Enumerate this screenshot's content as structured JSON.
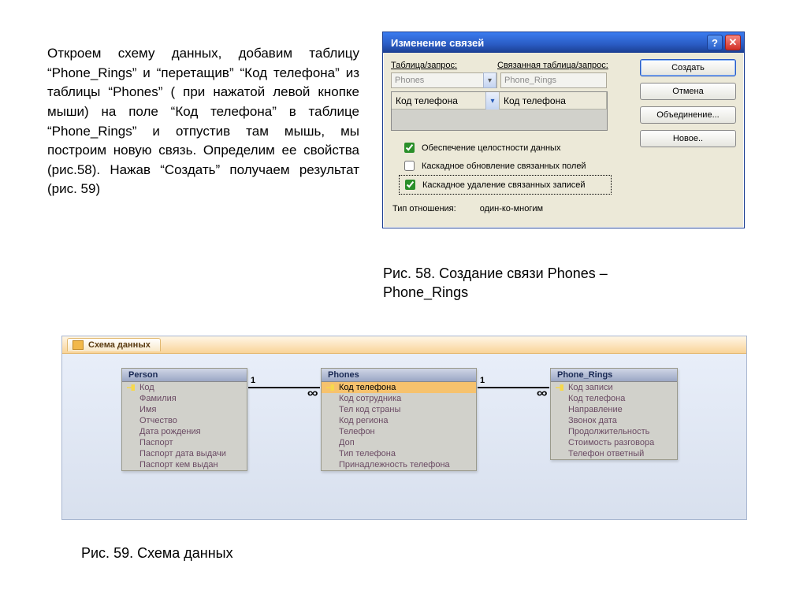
{
  "explain_text": "Откроем схему данных, добавим таблицу “Phone_Rings” и “перетащив” “Код телефона” из таблицы “Phones” ( при нажатой левой кнопке мыши) на поле “Код телефона” в таблице “Phone_Rings” и отпустив там мышь, мы построим новую связь. Определим ее свойства (рис.58). Нажав “Создать” получаем результат (рис. 59)",
  "caption_58": "Рис. 58. Создание связи Phones – Phone_Rings",
  "caption_59": "Рис. 59. Схема данных",
  "dialog": {
    "title": "Изменение связей",
    "label_table": "Таблица/запрос:",
    "label_related": "Связанная таблица/запрос:",
    "table_left": "Phones",
    "table_right": "Phone_Rings",
    "field_left": "Код телефона",
    "field_right": "Код телефона",
    "buttons": {
      "create": "Создать",
      "cancel": "Отмена",
      "join": "Объединение...",
      "new": "Новое.."
    },
    "checks": {
      "integrity": "Обеспечение целостности данных",
      "cascade_update": "Каскадное обновление связанных полей",
      "cascade_delete": "Каскадное удаление связанных записей"
    },
    "relationship_label": "Тип отношения:",
    "relationship_value": "один-ко-многим"
  },
  "schema": {
    "tab_title": "Схема данных",
    "tables": {
      "person": {
        "title": "Person",
        "fields": [
          "Код",
          "Фамилия",
          "Имя",
          "Отчество",
          "Дата рождения",
          "Паспорт",
          "Паспорт дата выдачи",
          "Паспорт кем выдан"
        ]
      },
      "phones": {
        "title": "Phones",
        "fields": [
          "Код телефона",
          "Код сотрудника",
          "Тел код страны",
          "Код региона",
          "Телефон",
          "Доп",
          "Тип телефона",
          "Принадлежность телефона"
        ]
      },
      "rings": {
        "title": "Phone_Rings",
        "fields": [
          "Код записи",
          "Код телефона",
          "Направление",
          "Звонок дата",
          "Продолжительность",
          "Стоимость разговора",
          "Телефон ответный"
        ]
      }
    }
  }
}
